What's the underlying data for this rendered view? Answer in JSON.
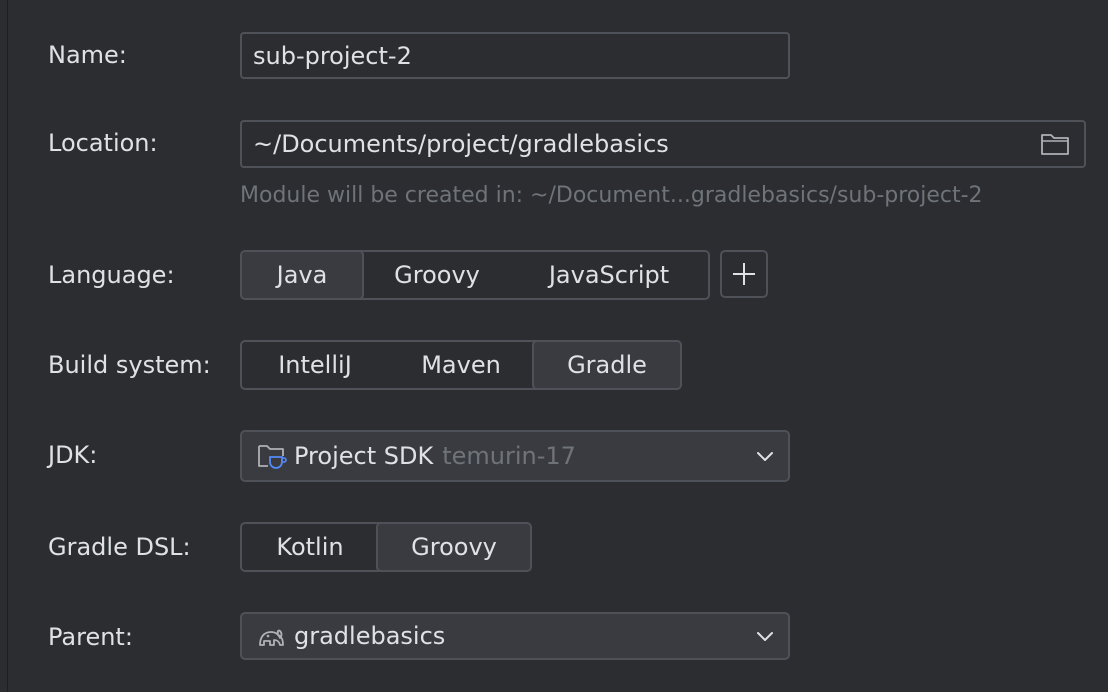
{
  "form": {
    "name_label": "Name:",
    "name_value": "sub-project-2",
    "location_label": "Location:",
    "location_value": "~/Documents/project/gradlebasics",
    "location_hint": "Module will be created in: ~/Document...gradlebasics/sub-project-2",
    "language_label": "Language:",
    "languages": [
      "Java",
      "Groovy",
      "JavaScript"
    ],
    "language_selected": "Java",
    "build_label": "Build system:",
    "build_systems": [
      "IntelliJ",
      "Maven",
      "Gradle"
    ],
    "build_selected": "Gradle",
    "jdk_label": "JDK:",
    "jdk_value": "Project SDK",
    "jdk_detail": "temurin-17",
    "dsl_label": "Gradle DSL:",
    "dsls": [
      "Kotlin",
      "Groovy"
    ],
    "dsl_selected": "Groovy",
    "parent_label": "Parent:",
    "parent_value": "gradlebasics"
  },
  "icons": {
    "browse": "folder-icon",
    "add": "plus-icon",
    "jdk": "project-sdk-folder-icon",
    "parent": "gradle-elephant-icon",
    "dropdown": "chevron-down-icon"
  },
  "colors": {
    "background": "#2b2d30",
    "border": "#4e5157",
    "selected_bg": "#393b40",
    "text": "#dfe1e5",
    "muted": "#6f737a",
    "sdk_icon_accent": "#548af7"
  }
}
